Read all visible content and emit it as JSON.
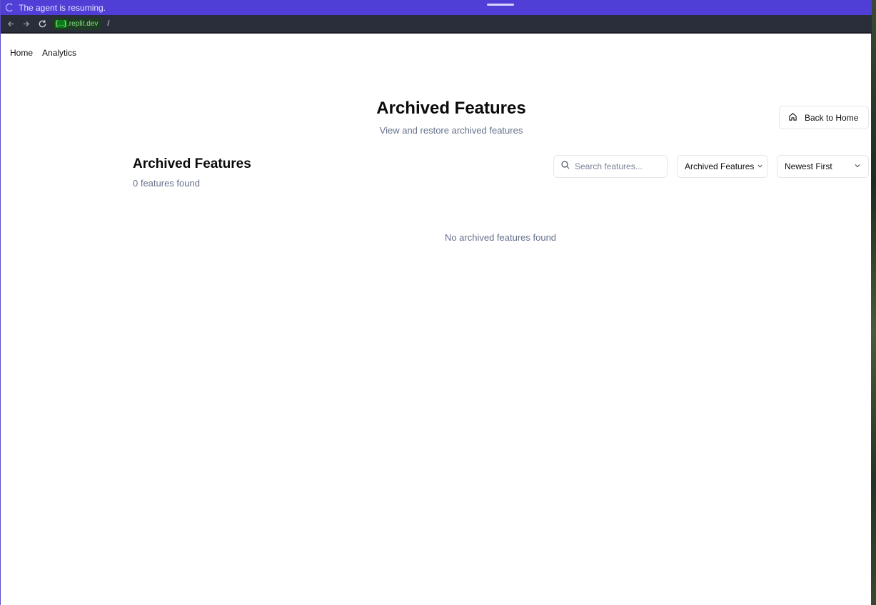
{
  "agent_bar": {
    "status": "The agent is resuming."
  },
  "url_bar": {
    "domain_highlight": "{...}",
    "domain_rest": ".replit.dev",
    "path": "/"
  },
  "nav": {
    "items": [
      "Home",
      "Analytics"
    ]
  },
  "header": {
    "title": "Archived Features",
    "subtitle": "View and restore archived features",
    "back_button": "Back to Home"
  },
  "section": {
    "title": "Archived Features",
    "count": "0 features found"
  },
  "controls": {
    "search_placeholder": "Search features...",
    "filter_value": "Archived Features",
    "sort_value": "Newest First"
  },
  "empty_state": "No archived features found",
  "colors": {
    "agent_bar": "#4f3fd6",
    "muted_text": "#64708a"
  }
}
